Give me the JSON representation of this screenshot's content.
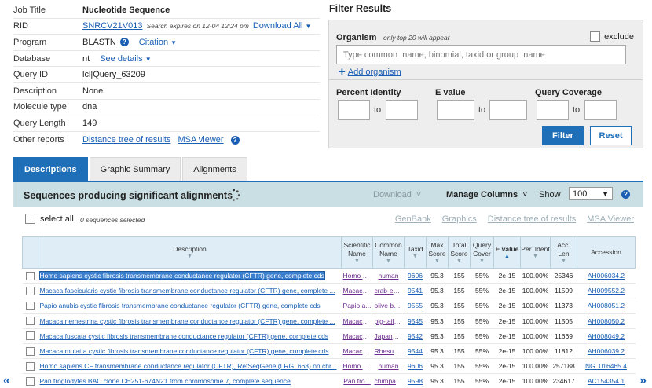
{
  "job": {
    "rows": [
      {
        "label": "Job Title",
        "value": "Nucleotide Sequence"
      },
      {
        "label": "RID",
        "rid": "SNRCV21V013",
        "expires": "Search expires on 12-04 12:24 pm",
        "download": "Download All"
      },
      {
        "label": "Program",
        "value": "BLASTN",
        "citation": "Citation"
      },
      {
        "label": "Database",
        "value": "nt",
        "details": "See details"
      },
      {
        "label": "Query ID",
        "value": "lcl|Query_63209"
      },
      {
        "label": "Description",
        "value": "None"
      },
      {
        "label": "Molecule type",
        "value": "dna"
      },
      {
        "label": "Query Length",
        "value": "149"
      },
      {
        "label": "Other reports",
        "link1": "Distance tree of results",
        "link2": "MSA viewer"
      }
    ]
  },
  "filter": {
    "title": "Filter Results",
    "organism_label": "Organism",
    "organism_note": "only top 20 will appear",
    "exclude_label": "exclude",
    "organism_placeholder": "Type common  name, binomial, taxid or group  name",
    "add_organism": "Add organism",
    "percent_identity": "Percent Identity",
    "e_value": "E value",
    "query_coverage": "Query Coverage",
    "to": "to",
    "filter_button": "Filter",
    "reset_button": "Reset"
  },
  "tabs": [
    {
      "label": "Descriptions",
      "active": true
    },
    {
      "label": "Graphic Summary",
      "active": false
    },
    {
      "label": "Alignments",
      "active": false
    }
  ],
  "results": {
    "title": "Sequences producing significant alignments",
    "download": "Download",
    "manage_columns": "Manage Columns",
    "show_label": "Show",
    "show_value": "100",
    "select_all": "select all",
    "selected_count": "0 sequences selected",
    "links": [
      "GenBank",
      "Graphics",
      "Distance tree of results",
      "MSA Viewer"
    ]
  },
  "table": {
    "headers": [
      "Description",
      "Scientific Name",
      "Common Name",
      "Taxid",
      "Max Score",
      "Total Score",
      "Query Cover",
      "E value",
      "Per. Ident",
      "Acc. Len",
      "Accession"
    ],
    "rows": [
      [
        "Homo sapiens cystic fibrosis transmembrane conductance regulator (CFTR) gene, complete cds",
        "Homo s...",
        "human",
        "9606",
        "95.3",
        "155",
        "55%",
        "2e-15",
        "100.00%",
        "25346",
        "AH006034.2"
      ],
      [
        "Macaca fascicularis cystic fibrosis transmembrane conductance regulator (CFTR) gene, complete ...",
        "Macaca...",
        "crab-eat...",
        "9541",
        "95.3",
        "155",
        "55%",
        "2e-15",
        "100.00%",
        "11509",
        "AH009552.2"
      ],
      [
        "Papio anubis cystic fibrosis transmembrane conductance regulator (CFTR) gene, complete cds",
        "Papio a...",
        "olive ba...",
        "9555",
        "95.3",
        "155",
        "55%",
        "2e-15",
        "100.00%",
        "11373",
        "AH008051.2"
      ],
      [
        "Macaca nemestrina cystic fibrosis transmembrane conductance regulator (CFTR) gene, complete ...",
        "Macaca...",
        "pig-taile...",
        "9545",
        "95.3",
        "155",
        "55%",
        "2e-15",
        "100.00%",
        "11505",
        "AH008050.2"
      ],
      [
        "Macaca fuscata cystic fibrosis transmembrane conductance regulator (CFTR) gene, complete cds",
        "Macaca...",
        "Japanes...",
        "9542",
        "95.3",
        "155",
        "55%",
        "2e-15",
        "100.00%",
        "11669",
        "AH008049.2"
      ],
      [
        "Macaca mulatta cystic fibrosis transmembrane conductance regulator (CFTR) gene, complete cds",
        "Macaca...",
        "Rhesus ...",
        "9544",
        "95.3",
        "155",
        "55%",
        "2e-15",
        "100.00%",
        "11812",
        "AH006039.2"
      ],
      [
        "Homo sapiens CF transmembrane conductance regulator (CFTR), RefSeqGene (LRG_663) on chr...",
        "Homo s...",
        "human",
        "9606",
        "95.3",
        "155",
        "55%",
        "2e-15",
        "100.00%",
        "257188",
        "NG_016465.4"
      ],
      [
        "Pan troglodytes BAC clone CH251-674N21 from chromosome 7, complete sequence",
        "Pan tro...",
        "chimpan...",
        "9598",
        "95.3",
        "155",
        "55%",
        "2e-15",
        "100.00%",
        "234617",
        "AC154354.1"
      ]
    ]
  }
}
